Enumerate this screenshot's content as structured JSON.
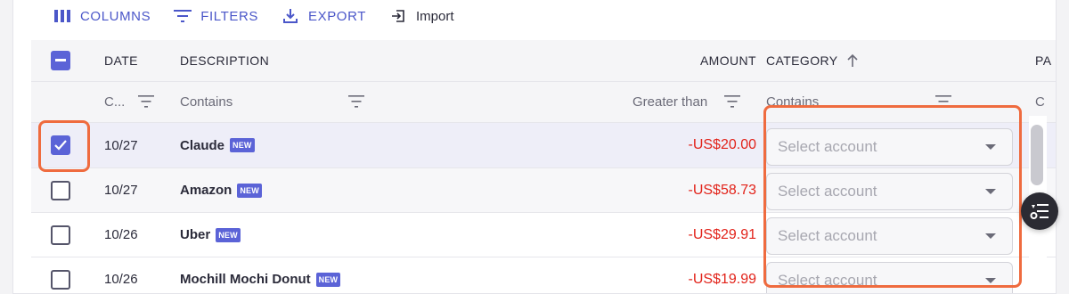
{
  "toolbar": {
    "columns_label": "COLUMNS",
    "filters_label": "FILTERS",
    "export_label": "EXPORT",
    "import_label": "Import"
  },
  "table": {
    "headers": {
      "date": "DATE",
      "description": "DESCRIPTION",
      "amount": "AMOUNT",
      "category": "CATEGORY",
      "partial_next": "PA"
    },
    "filters": {
      "date": "C...",
      "description": "Contains",
      "amount": "Greater than",
      "category": "Contains",
      "partial_next": "C"
    },
    "badge_label": "NEW",
    "rows": [
      {
        "checked": true,
        "date": "10/27",
        "description": "Claude",
        "amount": "-US$20.00",
        "category_placeholder": "Select account"
      },
      {
        "checked": false,
        "date": "10/27",
        "description": "Amazon",
        "amount": "-US$58.73",
        "category_placeholder": "Select account"
      },
      {
        "checked": false,
        "date": "10/26",
        "description": "Uber",
        "amount": "-US$29.91",
        "category_placeholder": "Select account"
      },
      {
        "checked": false,
        "date": "10/26",
        "description": "Mochill Mochi Donut",
        "amount": "-US$19.99",
        "category_placeholder": "Select account"
      }
    ]
  },
  "colors": {
    "accent": "#5b63d7",
    "negative_amount": "#e2231a",
    "highlight": "#ef6b3f"
  }
}
